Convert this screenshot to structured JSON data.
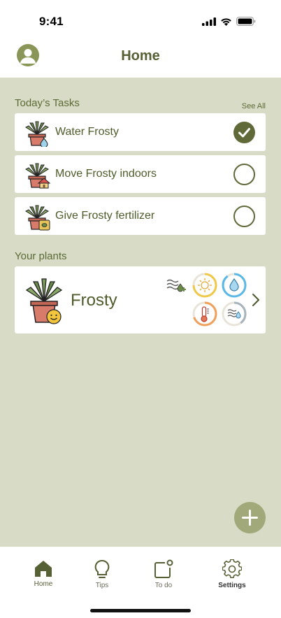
{
  "status_bar": {
    "time": "9:41"
  },
  "header": {
    "title": "Home"
  },
  "tasks": {
    "heading": "Today’s Tasks",
    "see_all": "See All",
    "items": [
      {
        "label": "Water Frosty",
        "done": true
      },
      {
        "label": "Move Frosty indoors",
        "done": false
      },
      {
        "label": "Give Frosty fertilizer",
        "done": false
      }
    ]
  },
  "plants": {
    "heading": "Your plants",
    "items": [
      {
        "name": "Frosty",
        "levels": {
          "sun": 0.75,
          "water": 0.9,
          "temperature": 0.7,
          "humidity": 0.4
        }
      }
    ]
  },
  "tabbar": {
    "items": [
      {
        "label": "Home"
      },
      {
        "label": "Tips"
      },
      {
        "label": "To do"
      },
      {
        "label": "Settings"
      }
    ]
  },
  "colors": {
    "accent": "#606a38",
    "background": "#d8dcc6",
    "fab": "#a1a87a"
  }
}
